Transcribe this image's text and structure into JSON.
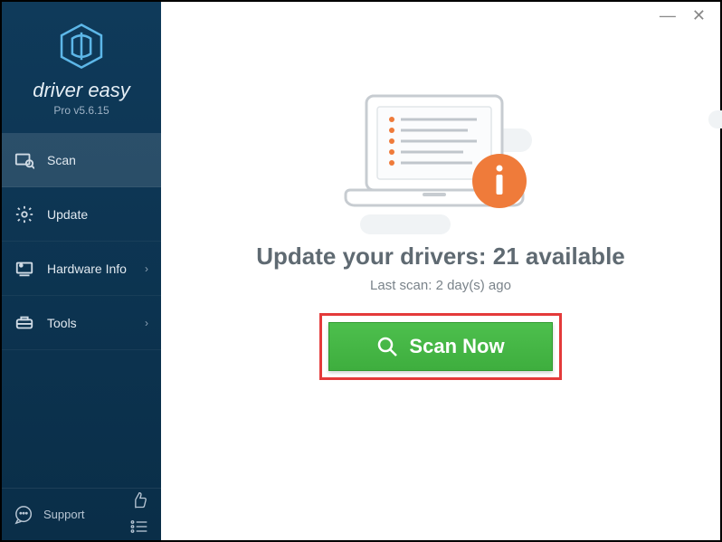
{
  "brand": {
    "name": "driver easy",
    "version_label": "Pro v5.6.15"
  },
  "sidebar": {
    "items": [
      {
        "label": "Scan",
        "icon": "scan-icon",
        "active": true,
        "chevron": false
      },
      {
        "label": "Update",
        "icon": "gear-icon",
        "active": false,
        "chevron": false
      },
      {
        "label": "Hardware Info",
        "icon": "hardware-icon",
        "active": false,
        "chevron": true
      },
      {
        "label": "Tools",
        "icon": "tools-icon",
        "active": false,
        "chevron": true
      }
    ],
    "support_label": "Support"
  },
  "main": {
    "headline_prefix": "Update your drivers: ",
    "available_count": 21,
    "headline_suffix": " available",
    "last_scan_prefix": "Last scan: ",
    "last_scan_value": "2 day(s) ago",
    "scan_button_label": "Scan Now"
  },
  "colors": {
    "accent_orange": "#ef7b3a",
    "scan_green": "#4dbf4d",
    "highlight_red": "#e43a3a",
    "sidebar_bg": "#0f3a5a"
  }
}
